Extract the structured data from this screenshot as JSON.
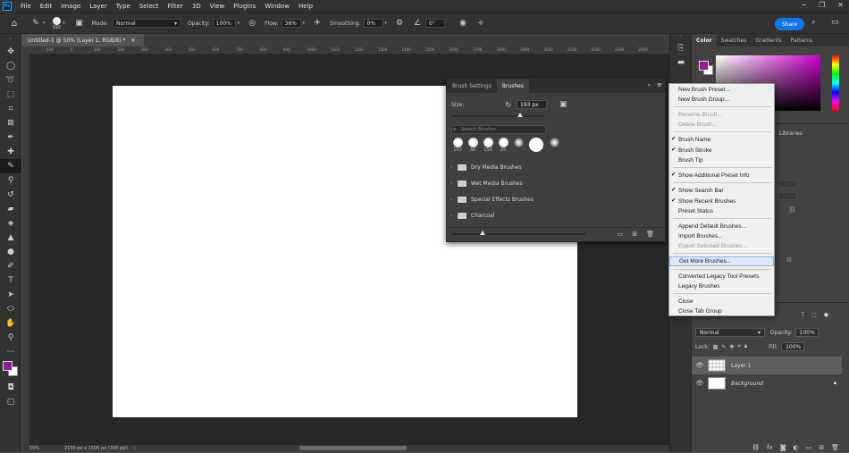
{
  "menubar": {
    "logo": "Ps",
    "items": [
      "File",
      "Edit",
      "Image",
      "Layer",
      "Type",
      "Select",
      "Filter",
      "3D",
      "View",
      "Plugins",
      "Window",
      "Help"
    ]
  },
  "options": {
    "brush_size": "192",
    "mode_label": "Mode:",
    "mode_value": "Normal",
    "opacity_label": "Opacity:",
    "opacity_value": "100%",
    "flow_label": "Flow:",
    "flow_value": "36%",
    "smoothing_label": "Smoothing:",
    "smoothing_value": "0%",
    "angle_value": "0°",
    "share_label": "Share"
  },
  "document": {
    "tab_title": "Untitled-1 @ 50% (Layer 1, RGB/8) *",
    "zoom": "50%",
    "doc_info": "2100 px x 1500 px (300 ppi)",
    "ruler_ticks": [
      "100",
      "0",
      "100",
      "200",
      "300",
      "400",
      "500",
      "600",
      "700",
      "800",
      "900",
      "1000",
      "1100",
      "1200",
      "1300",
      "1400",
      "1500",
      "1600",
      "1700",
      "1800",
      "1900",
      "2000",
      "2100",
      "2200",
      "2300",
      "2400"
    ]
  },
  "brush_panel": {
    "tab_settings": "Brush Settings",
    "tab_brushes": "Brushes",
    "size_label": "Size:",
    "size_value": "193 px",
    "search_placeholder": "Search Brushes",
    "recent": [
      "193",
      "30",
      "158",
      "25",
      "",
      "",
      ""
    ],
    "folders": [
      "Dry Media Brushes",
      "Wet Media Brushes",
      "Special Effects Brushes",
      "Charcoal"
    ]
  },
  "flyout_menu": {
    "items": [
      {
        "label": "New Brush Preset...",
        "checked": false,
        "disabled": false
      },
      {
        "label": "New Brush Group...",
        "checked": false,
        "disabled": false
      },
      {
        "label": "Rename Brush...",
        "checked": false,
        "disabled": true
      },
      {
        "label": "Delete Brush...",
        "checked": false,
        "disabled": true
      },
      {
        "label": "Brush Name",
        "checked": true,
        "disabled": false
      },
      {
        "label": "Brush Stroke",
        "checked": true,
        "disabled": false
      },
      {
        "label": "Brush Tip",
        "checked": false,
        "disabled": false
      },
      {
        "label": "Show Additional Preset Info",
        "checked": true,
        "disabled": false
      },
      {
        "label": "Show Search Bar",
        "checked": true,
        "disabled": false
      },
      {
        "label": "Show Recent Brushes",
        "checked": true,
        "disabled": false
      },
      {
        "label": "Preset Status",
        "checked": false,
        "disabled": false
      },
      {
        "label": "Append Default Brushes...",
        "checked": false,
        "disabled": false
      },
      {
        "label": "Import Brushes...",
        "checked": false,
        "disabled": false
      },
      {
        "label": "Export Selected Brushes...",
        "checked": false,
        "disabled": true
      },
      {
        "label": "Get More Brushes...",
        "checked": false,
        "disabled": false,
        "hover": true
      },
      {
        "label": "Converted Legacy Tool Presets",
        "checked": false,
        "disabled": false
      },
      {
        "label": "Legacy Brushes",
        "checked": false,
        "disabled": false
      },
      {
        "label": "Close",
        "checked": false,
        "disabled": false
      },
      {
        "label": "Close Tab Group",
        "checked": false,
        "disabled": false
      }
    ]
  },
  "color_panel": {
    "tabs": [
      "Color",
      "Swatches",
      "Gradients",
      "Patterns"
    ],
    "foreground": "#8e1e8e",
    "background": "#ffffff",
    "libraries_label": "Libraries"
  },
  "layers_panel": {
    "blend_mode": "Normal",
    "opacity_label": "Opacity:",
    "opacity_value": "100%",
    "lock_label": "Lock:",
    "fill_label": "Fill:",
    "fill_value": "100%",
    "layers": [
      {
        "name": "Layer 1",
        "selected": true
      },
      {
        "name": "Background",
        "selected": false
      }
    ]
  }
}
